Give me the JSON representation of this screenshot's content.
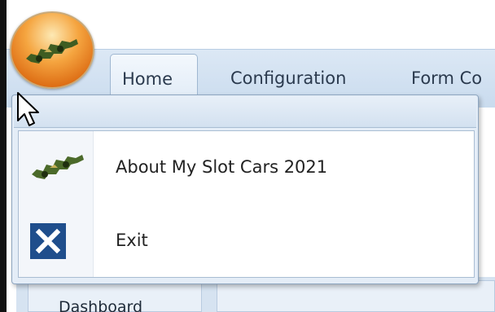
{
  "ribbon": {
    "tabs": [
      {
        "label": "Home",
        "active": true
      },
      {
        "label": "Configuration",
        "active": false
      },
      {
        "label": "Form Co",
        "active": false
      }
    ]
  },
  "app_menu": {
    "items": [
      {
        "label": "About My Slot Cars 2021",
        "icon": "slot-car-logo-icon"
      },
      {
        "label": "Exit",
        "icon": "close-icon"
      }
    ]
  },
  "background": {
    "partial_text": "Dashboard"
  },
  "colors": {
    "app_button_orange": "#f5a540",
    "ribbon_blue": "#c9dbee",
    "exit_icon_blue": "#1f4e8c",
    "logo_green": "#4b6a2a"
  }
}
